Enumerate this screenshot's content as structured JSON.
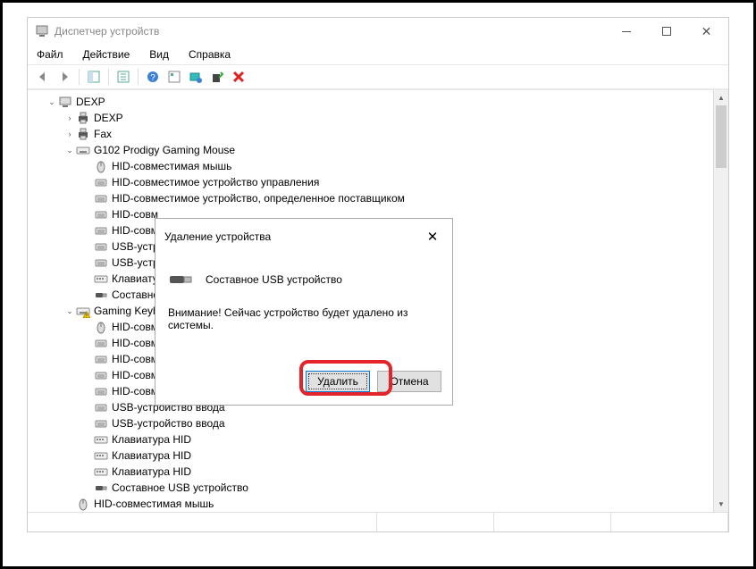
{
  "window": {
    "title": "Диспетчер устройств"
  },
  "menu": {
    "file": "Файл",
    "action": "Действие",
    "view": "Вид",
    "help": "Справка"
  },
  "tree": {
    "root": "DEXP",
    "items": [
      {
        "indent": 1,
        "exp": "›",
        "icon": "printer",
        "text": "DEXP"
      },
      {
        "indent": 1,
        "exp": "›",
        "icon": "printer",
        "text": "Fax"
      },
      {
        "indent": 1,
        "exp": "⌄",
        "icon": "kbdgroup",
        "text": "G102 Prodigy Gaming Mouse"
      },
      {
        "indent": 2,
        "exp": "",
        "icon": "mouse",
        "text": "HID-совместимая мышь"
      },
      {
        "indent": 2,
        "exp": "",
        "icon": "hid",
        "text": "HID-совместимое устройство управления"
      },
      {
        "indent": 2,
        "exp": "",
        "icon": "hid",
        "text": "HID-совместимое устройство, определенное поставщиком"
      },
      {
        "indent": 2,
        "exp": "",
        "icon": "hid",
        "text": "HID-совм"
      },
      {
        "indent": 2,
        "exp": "",
        "icon": "hid",
        "text": "HID-совм"
      },
      {
        "indent": 2,
        "exp": "",
        "icon": "hid",
        "text": "USB-устр"
      },
      {
        "indent": 2,
        "exp": "",
        "icon": "hid",
        "text": "USB-устр"
      },
      {
        "indent": 2,
        "exp": "",
        "icon": "kbd",
        "text": "Клавиату"
      },
      {
        "indent": 2,
        "exp": "",
        "icon": "usb",
        "text": "Составно"
      },
      {
        "indent": 1,
        "exp": "⌄",
        "icon": "kbdgroup-warn",
        "text": "Gaming Keyb"
      },
      {
        "indent": 2,
        "exp": "",
        "icon": "mouse",
        "text": "HID-совм"
      },
      {
        "indent": 2,
        "exp": "",
        "icon": "hid",
        "text": "HID-совм"
      },
      {
        "indent": 2,
        "exp": "",
        "icon": "hid",
        "text": "HID-совм"
      },
      {
        "indent": 2,
        "exp": "",
        "icon": "hid",
        "text": "HID-совм"
      },
      {
        "indent": 2,
        "exp": "",
        "icon": "hid",
        "text": "HID-совм"
      },
      {
        "indent": 2,
        "exp": "",
        "icon": "hid",
        "text": "USB-устройство ввода"
      },
      {
        "indent": 2,
        "exp": "",
        "icon": "hid",
        "text": "USB-устройство ввода"
      },
      {
        "indent": 2,
        "exp": "",
        "icon": "kbd",
        "text": "Клавиатура HID"
      },
      {
        "indent": 2,
        "exp": "",
        "icon": "kbd",
        "text": "Клавиатура HID"
      },
      {
        "indent": 2,
        "exp": "",
        "icon": "kbd",
        "text": "Клавиатура HID"
      },
      {
        "indent": 2,
        "exp": "",
        "icon": "usb",
        "text": "Составное USB устройство"
      },
      {
        "indent": 1,
        "exp": "",
        "icon": "mouse",
        "text": "HID-совместимая мышь"
      }
    ]
  },
  "dialog": {
    "title": "Удаление устройства",
    "device": "Составное USB устройство",
    "warning": "Внимание! Сейчас устройство будет удалено из системы.",
    "delete": "Удалить",
    "cancel": "Отмена"
  }
}
